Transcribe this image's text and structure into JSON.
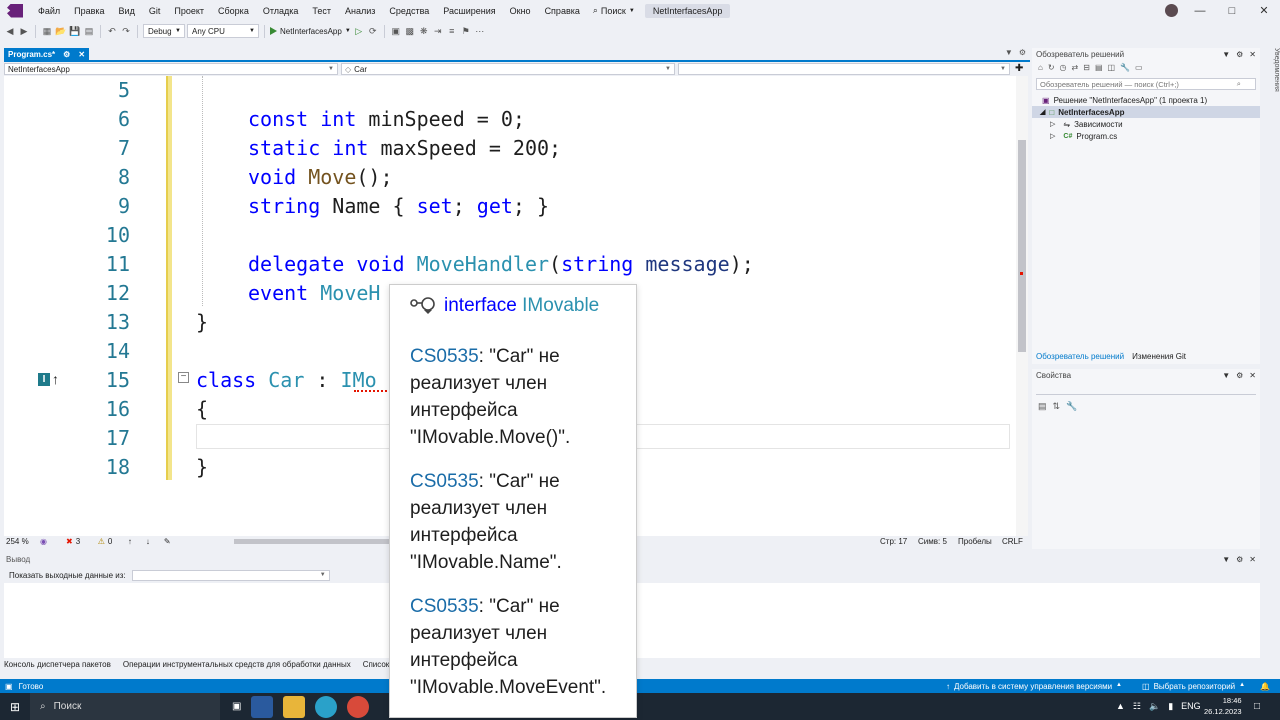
{
  "menu": {
    "items": [
      "Файл",
      "Правка",
      "Вид",
      "Git",
      "Проект",
      "Сборка",
      "Отладка",
      "Тест",
      "Анализ",
      "Средства",
      "Расширения",
      "Окно",
      "Справка"
    ],
    "search": "Поиск",
    "solution_title": "NetInterfacesApp"
  },
  "toolbar": {
    "config": "Debug",
    "platform": "Any CPU",
    "run_target": "NetInterfacesApp"
  },
  "doc_tab": {
    "label": "Program.cs*"
  },
  "navbar": {
    "project": "NetInterfacesApp",
    "type": "Car",
    "member": ""
  },
  "code": {
    "lines": [
      {
        "num": "5"
      },
      {
        "num": "6"
      },
      {
        "num": "7"
      },
      {
        "num": "8"
      },
      {
        "num": "9"
      },
      {
        "num": "10"
      },
      {
        "num": "11"
      },
      {
        "num": "12"
      },
      {
        "num": "13"
      },
      {
        "num": "14"
      },
      {
        "num": "15"
      },
      {
        "num": "16"
      },
      {
        "num": "17"
      },
      {
        "num": "18"
      }
    ],
    "t": {
      "const": "const",
      "int": "int",
      "minSpeed": " minSpeed = 0;",
      "static": "static",
      "maxSpeed": " maxSpeed = 200;",
      "void": "void",
      "Move": "Move",
      "moveRest": "();",
      "string": "string",
      "name": " Name { ",
      "set": "set",
      "semi1": "; ",
      "get": "get",
      "semi2": "; }",
      "delegate": "delegate",
      "MoveHandler": "MoveHandler",
      "paren": "(",
      "message": "message",
      "close": ");",
      "event": "event",
      "MoveH": "MoveH",
      "brace_close": "}",
      "class": "class",
      "Car": "Car",
      "colon": " : ",
      "IMo": "IMo",
      "brace_open": "{"
    }
  },
  "editor_status": {
    "zoom": "254 %",
    "errors": "3",
    "warnings": "0",
    "line": "Стр: 17",
    "col": "Симв: 5",
    "spaces": "Пробелы",
    "eol": "CRLF"
  },
  "output": {
    "title": "Вывод",
    "show_from": "Показать выходные данные из:"
  },
  "bottom_tabs": [
    "Консоль диспетчера пакетов",
    "Операции инструментальных средств для обработки данных",
    "Список о"
  ],
  "statusbar": {
    "ready": "Готово",
    "vcs": "Добавить в систему управления версиями",
    "repo": "Выбрать репозиторий"
  },
  "taskbar": {
    "search": "Поиск",
    "lang": "ENG",
    "time": "18:46",
    "date": "26.12.2023"
  },
  "solution_explorer": {
    "title": "Обозреватель решений",
    "search_placeholder": "Обозреватель решений — поиск (Ctrl+;)",
    "solution": "Решение \"NetInterfacesApp\" (1 проекта 1)",
    "project": "NetInterfacesApp",
    "deps": "Зависимости",
    "file": "Program.cs",
    "tab_se": "Обозреватель решений",
    "tab_git": "Изменения Git"
  },
  "properties": {
    "title": "Свойства"
  },
  "notifications": "Уведомления",
  "quickinfo": {
    "kind": "interface",
    "name": "IMovable",
    "messages": [
      {
        "code": "CS0535",
        "text": ": \"Car\" не реализует член интерфейса \"IMovable.Move()\"."
      },
      {
        "code": "CS0535",
        "text": ": \"Car\" не реализует член интерфейса \"IMovable.Name\"."
      },
      {
        "code": "CS0535",
        "text": ": \"Car\" не реализует член интерфейса \"IMovable.MoveEvent\"."
      }
    ]
  },
  "colors": {
    "accent": "#007acc",
    "keyword": "#0000ff",
    "type": "#2b91af",
    "error": "#e51400"
  }
}
